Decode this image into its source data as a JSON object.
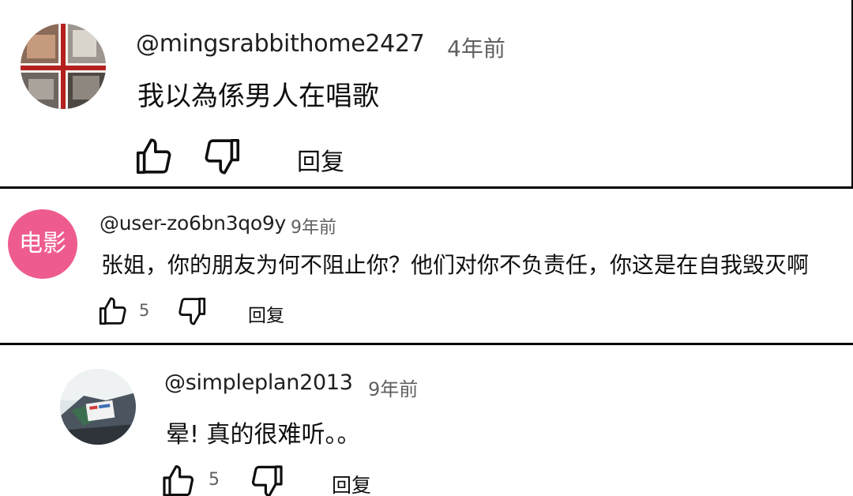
{
  "comments": [
    {
      "username": "@mingsrabbithome2427",
      "time": "4年前",
      "text": "我以為係男人在唱歌",
      "like_count": "",
      "reply_label": "回复",
      "avatar_icon": "photo-collage-avatar"
    },
    {
      "username": "@user-zo6bn3qo9y",
      "time": "9年前",
      "text": "张姐，你的朋友为何不阻止你？他们对你不负责任，你这是在自我毁灭啊",
      "like_count": "5",
      "reply_label": "回复",
      "avatar_label": "电影",
      "avatar_color": "#ee5c8f"
    },
    {
      "username": "@simpleplan2013",
      "time": "9年前",
      "text": "晕! 真的很难听。。",
      "like_count": "5",
      "reply_label": "回复",
      "avatar_icon": "photo-avatar"
    }
  ],
  "icons": {
    "like": "thumbs-up-icon",
    "dislike": "thumbs-down-icon"
  },
  "colors": {
    "background": "#ffffff",
    "separator": "#000000",
    "text": "#0f0f0f",
    "secondary_text": "#606060"
  }
}
